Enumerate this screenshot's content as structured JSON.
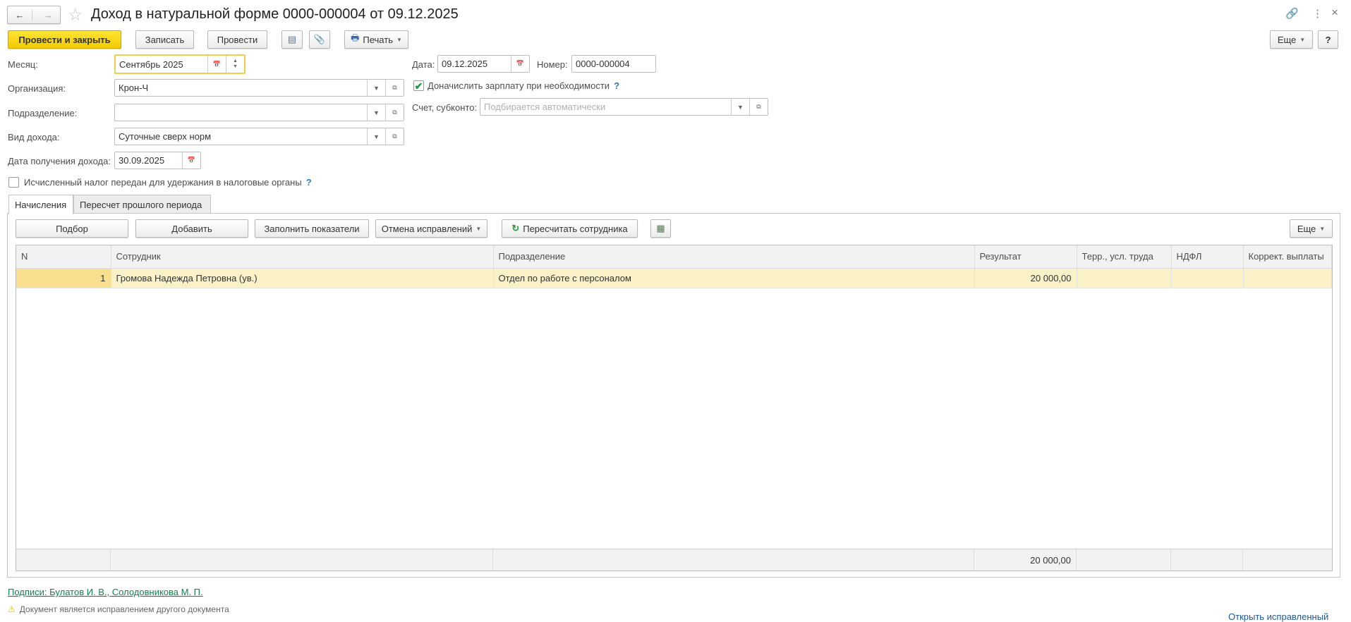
{
  "header": {
    "title": "Доход в натуральной форме 0000-000004 от 09.12.2025",
    "back_icon": "arrow-left",
    "forward_icon": "arrow-right",
    "favorite_icon": "star"
  },
  "toolbar": {
    "post_close": "Провести и закрыть",
    "save": "Записать",
    "post": "Провести",
    "print": "Печать",
    "more": "Еще",
    "help": "?"
  },
  "form": {
    "month": {
      "label": "Месяц:",
      "value": "Сентябрь 2025"
    },
    "organization": {
      "label": "Организация:",
      "value": "Крон-Ч"
    },
    "department": {
      "label": "Подразделение:",
      "value": ""
    },
    "income_type": {
      "label": "Вид дохода:",
      "value": "Суточные сверх норм"
    },
    "income_date": {
      "label": "Дата получения дохода:",
      "value": "30.09.2025"
    },
    "tax_transferred": {
      "label": "Исчисленный налог передан для удержания в налоговые органы",
      "checked": false,
      "help": "?"
    },
    "date": {
      "label": "Дата:",
      "value": "09.12.2025"
    },
    "number": {
      "label": "Номер:",
      "value": "0000-000004"
    },
    "accrue_salary": {
      "label": "Доначислить зарплату при необходимости",
      "checked": true,
      "help": "?"
    },
    "account": {
      "label": "Счет, субконто:",
      "placeholder": "Подбирается автоматически"
    }
  },
  "tabs": [
    {
      "label": "Начисления",
      "active": true
    },
    {
      "label": "Пересчет прошлого периода",
      "active": false
    }
  ],
  "table_toolbar": {
    "select": "Подбор",
    "add": "Добавить",
    "fill": "Заполнить показатели",
    "cancel_corrections": "Отмена исправлений",
    "recalc": "Пересчитать сотрудника",
    "more": "Еще"
  },
  "table": {
    "columns": [
      "N",
      "Сотрудник",
      "Подразделение",
      "Результат",
      "Терр., усл. труда",
      "НДФЛ",
      "Коррект. выплаты"
    ],
    "rows": [
      {
        "n": "1",
        "employee": "Громова Надежда Петровна (ув.)",
        "department": "Отдел по работе с персоналом",
        "result": "20 000,00",
        "terr": "",
        "ndfl": "",
        "corr": ""
      }
    ],
    "total_result": "20 000,00"
  },
  "footer": {
    "signatures": "Подписи: Булатов И. В., Солодовникова М. П.",
    "warning": "Документ является исправлением другого документа",
    "open_corrected": "Открыть исправленный"
  }
}
